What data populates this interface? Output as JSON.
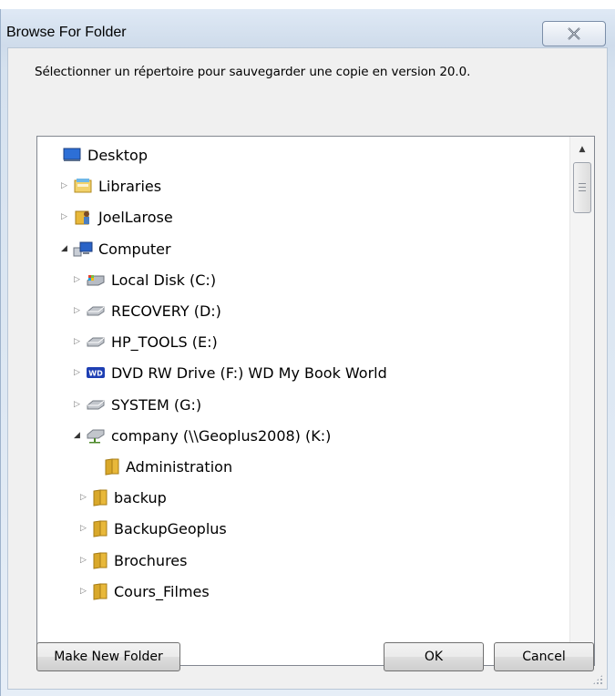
{
  "window": {
    "title": "Browse For Folder",
    "close_symbol": "✕"
  },
  "instruction": "Sélectionner un répertoire pour sauvegarder une copie en version 20.0.",
  "tree": [
    {
      "label": "Desktop",
      "icon": "desktop-icon",
      "expander": "none"
    },
    {
      "label": "Libraries",
      "icon": "libraries-icon",
      "expander": "collapsed"
    },
    {
      "label": "JoelLarose",
      "icon": "user-folder-icon",
      "expander": "collapsed"
    },
    {
      "label": "Computer",
      "icon": "computer-icon",
      "expander": "expanded"
    },
    {
      "label": "Local Disk (C:)",
      "icon": "local-disk-icon",
      "expander": "collapsed"
    },
    {
      "label": "RECOVERY (D:)",
      "icon": "drive-icon",
      "expander": "collapsed"
    },
    {
      "label": "HP_TOOLS (E:)",
      "icon": "drive-icon",
      "expander": "collapsed"
    },
    {
      "label": "DVD RW Drive (F:) WD My Book World",
      "icon": "wd-drive-icon",
      "expander": "collapsed"
    },
    {
      "label": "SYSTEM (G:)",
      "icon": "drive-icon",
      "expander": "collapsed"
    },
    {
      "label": "company (\\\\Geoplus2008) (K:)",
      "icon": "network-drive-icon",
      "expander": "expanded"
    },
    {
      "label": "Administration",
      "icon": "folder-icon",
      "expander": "none"
    },
    {
      "label": "backup",
      "icon": "folder-icon",
      "expander": "collapsed"
    },
    {
      "label": "BackupGeoplus",
      "icon": "folder-icon",
      "expander": "collapsed"
    },
    {
      "label": "Brochures",
      "icon": "folder-icon",
      "expander": "collapsed"
    },
    {
      "label": "Cours_Filmes",
      "icon": "folder-icon",
      "expander": "collapsed"
    }
  ],
  "buttons": {
    "make_new_folder": "Make New Folder",
    "ok": "OK",
    "cancel": "Cancel"
  },
  "colors": {
    "folder": "#e8b83a",
    "wd_badge": "#1e3fb3",
    "desktop": "#2d6fd6"
  }
}
